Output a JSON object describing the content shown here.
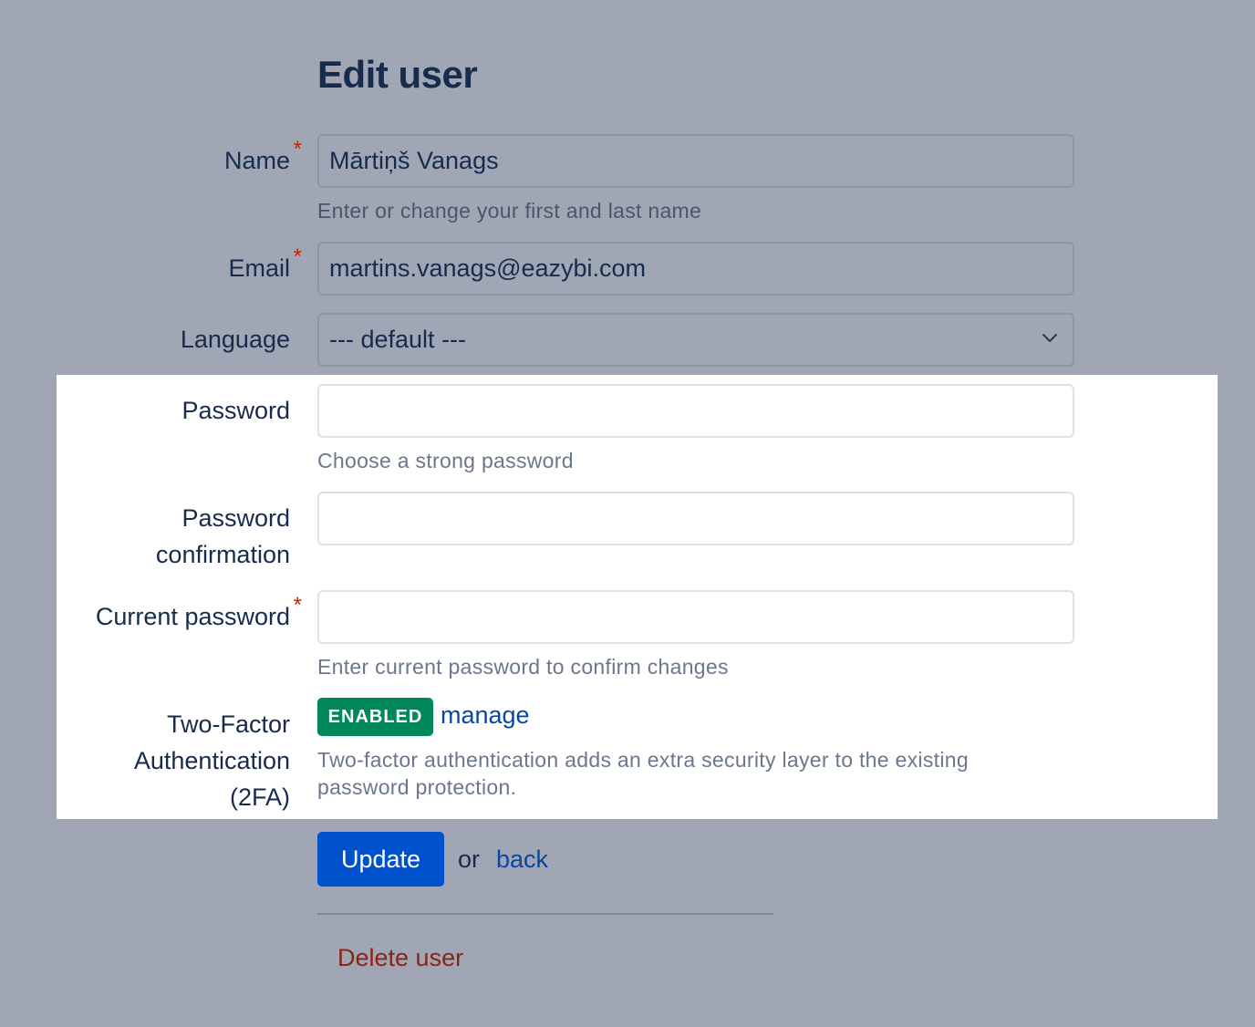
{
  "page": {
    "title": "Edit user"
  },
  "form": {
    "name": {
      "label": "Name",
      "required_mark": "*",
      "value": "Mārtiņš Vanags",
      "help": "Enter or change your first and last name"
    },
    "email": {
      "label": "Email",
      "required_mark": "*",
      "value": "martins.vanags@eazybi.com"
    },
    "language": {
      "label": "Language",
      "selected": "--- default ---"
    },
    "password": {
      "label": "Password",
      "value": "",
      "help": "Choose a strong password"
    },
    "password_confirmation": {
      "label_line1": "Password",
      "label_line2": "confirmation",
      "value": ""
    },
    "current_password": {
      "label": "Current password",
      "required_mark": "*",
      "value": "",
      "help": "Enter current password to confirm changes"
    },
    "two_factor": {
      "label_line1": "Two-Factor",
      "label_line2": "Authentication",
      "label_line3": "(2FA)",
      "status_badge": "ENABLED",
      "manage_link": "manage",
      "help_line1": "Two-factor authentication adds an extra security layer to the existing",
      "help_line2": "password protection."
    }
  },
  "actions": {
    "update_label": "Update",
    "or_text": "or",
    "back_label": "back",
    "delete_label": "Delete user"
  },
  "colors": {
    "overlay_background": "#a0a6b3",
    "highlight_background": "#ffffff",
    "primary_button": "#0052cc",
    "link": "#0747a6",
    "enabled_badge": "#00875a",
    "danger": "#8b2416",
    "required_mark": "#bf2600"
  },
  "icons": {
    "language_select_arrow": "chevron-down-icon"
  }
}
